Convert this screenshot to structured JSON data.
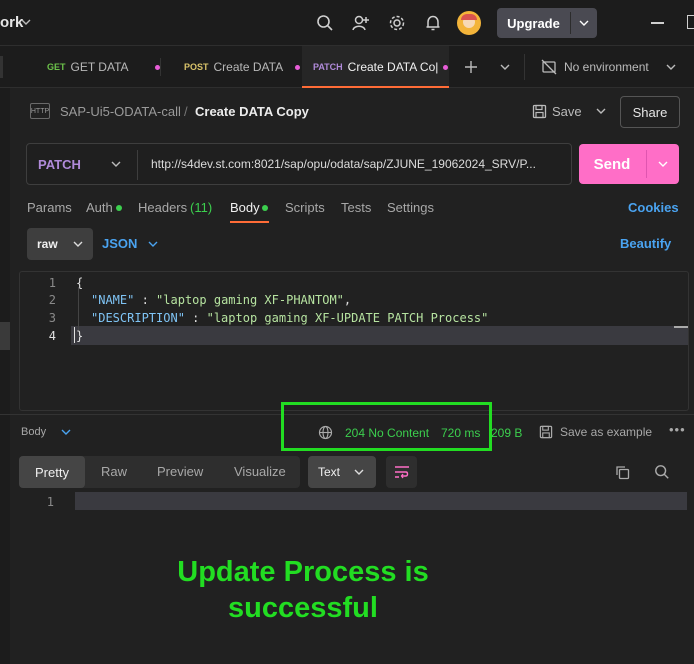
{
  "topbar": {
    "workspace_fragment": "ork",
    "upgrade_label": "Upgrade"
  },
  "tabs": [
    {
      "method": "GET",
      "label": "GET DATA",
      "method_color": "#6cc24a"
    },
    {
      "method": "POST",
      "label": "Create DATA",
      "method_color": "#d9c36a"
    },
    {
      "method": "PATCH",
      "label": "Create DATA Co|",
      "method_color": "#b08ad9"
    }
  ],
  "environment": "No environment",
  "breadcrumb": {
    "collection": "SAP-Ui5-ODATA-call",
    "separator": "/",
    "request": "Create DATA Copy",
    "http_badge": "HTTP"
  },
  "actions": {
    "save": "Save",
    "share": "Share"
  },
  "request": {
    "method": "PATCH",
    "url": "http://s4dev.st.com:8021/sap/opu/odata/sap/ZJUNE_19062024_SRV/P...",
    "send": "Send"
  },
  "request_tabs": {
    "params": "Params",
    "auth": "Auth",
    "headers": "Headers",
    "headers_count": "(11)",
    "body": "Body",
    "scripts": "Scripts",
    "tests": "Tests",
    "settings": "Settings",
    "cookies": "Cookies"
  },
  "body_options": {
    "mode": "raw",
    "format": "JSON",
    "beautify": "Beautify"
  },
  "editor": {
    "line_numbers": [
      "1",
      "2",
      "3",
      "4"
    ],
    "open_brace": "{",
    "close_brace": "}",
    "key1": "\"NAME\"",
    "value1": "\"laptop gaming XF-PHANTOM\"",
    "key2": "\"DESCRIPTION\"",
    "value2": "\"laptop gaming XF-UPDATE PATCH Process\"",
    "colon": " : ",
    "comma": ","
  },
  "response": {
    "section_label": "Body",
    "status": "204 No Content",
    "time": "720 ms",
    "size": "209 B",
    "save_example": "Save as example",
    "views": [
      "Pretty",
      "Raw",
      "Preview",
      "Visualize"
    ],
    "text_format": "Text",
    "line_number": "1"
  },
  "annotation": {
    "line1": "Update Process is",
    "line2": "successful",
    "highlight_color": "#22dd22"
  }
}
